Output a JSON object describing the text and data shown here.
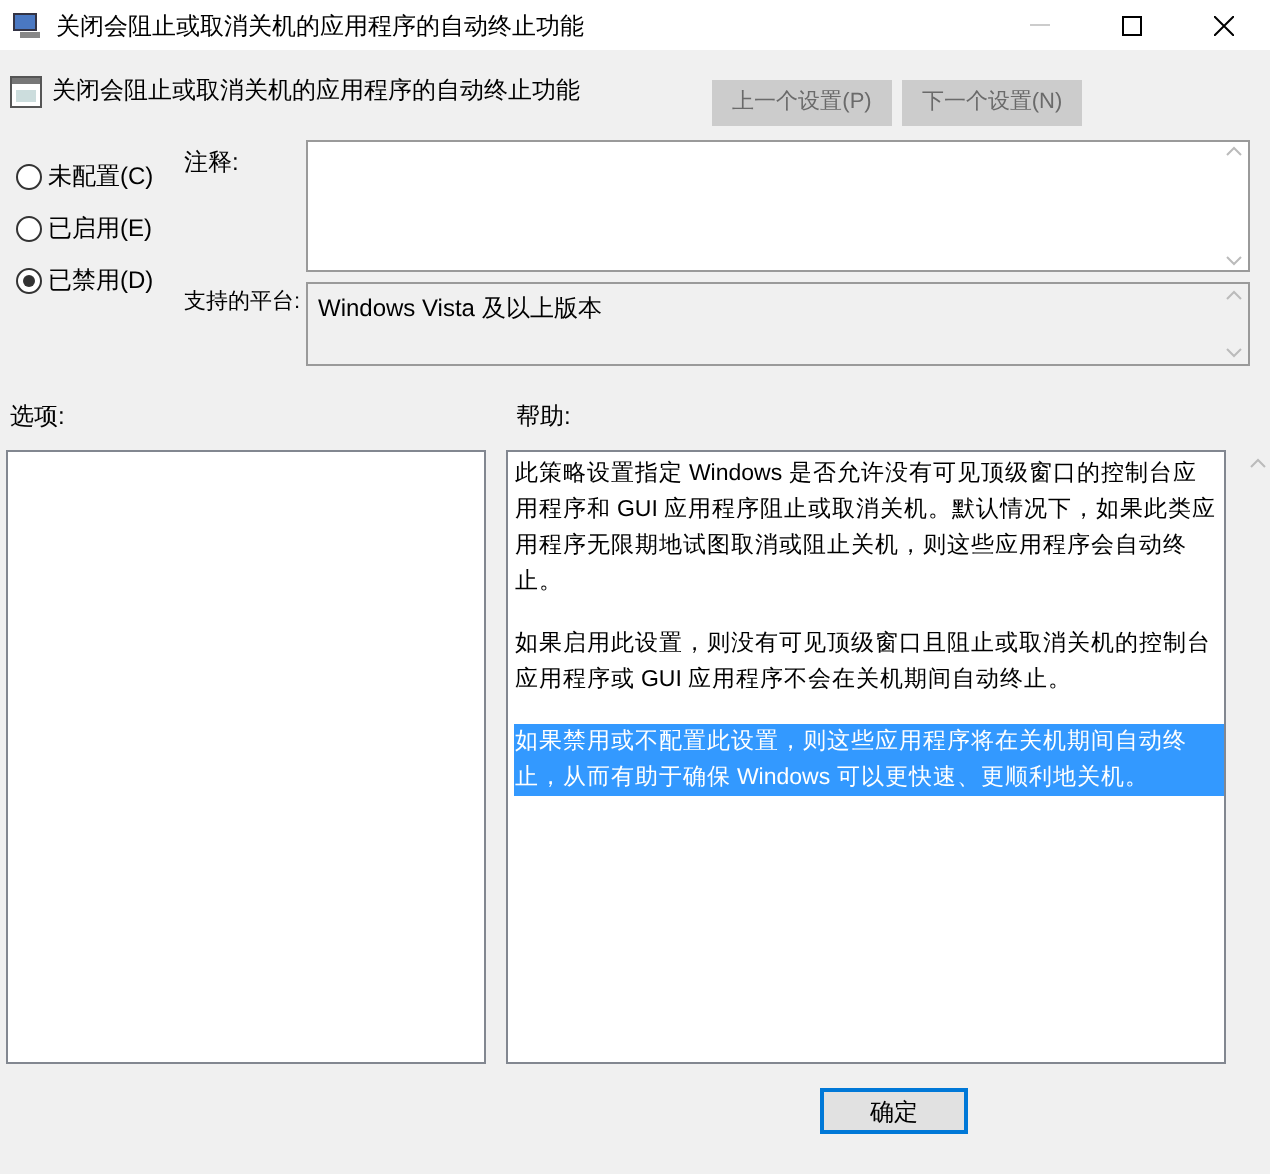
{
  "window": {
    "title": "关闭会阻止或取消关机的应用程序的自动终止功能"
  },
  "header": {
    "title": "关闭会阻止或取消关机的应用程序的自动终止功能"
  },
  "nav_buttons": [
    {
      "label": "上一个设置(P)",
      "disabled": true
    },
    {
      "label": "下一个设置(N)",
      "disabled": true
    }
  ],
  "states": [
    {
      "label": "未配置(C)",
      "selected": false
    },
    {
      "label": "已启用(E)",
      "selected": false
    },
    {
      "label": "已禁用(D)",
      "selected": true
    }
  ],
  "comment": {
    "label": "注释:"
  },
  "platform": {
    "label": "支持的平台:",
    "value": "Windows Vista 及以上版本"
  },
  "options": {
    "label": "选项:"
  },
  "help": {
    "label": "帮助:",
    "paragraphs": [
      {
        "text": "此策略设置指定 Windows 是否允许没有可见顶级窗口的控制台应用程序和 GUI 应用程序阻止或取消关机。默认情况下，如果此类应用程序无限期地试图取消或阻止关机，则这些应用程序会自动终止。",
        "selected": false
      },
      {
        "text": "如果启用此设置，则没有可见顶级窗口且阻止或取消关机的控制台应用程序或 GUI 应用程序不会在关机期间自动终止。",
        "selected": false
      },
      {
        "text": "如果禁用或不配置此设置，则这些应用程序将在关机期间自动终止，从而有助于确保 Windows 可以更快速、更顺利地关机。",
        "selected": true
      }
    ]
  },
  "buttons": [
    {
      "label": "确定"
    }
  ]
}
